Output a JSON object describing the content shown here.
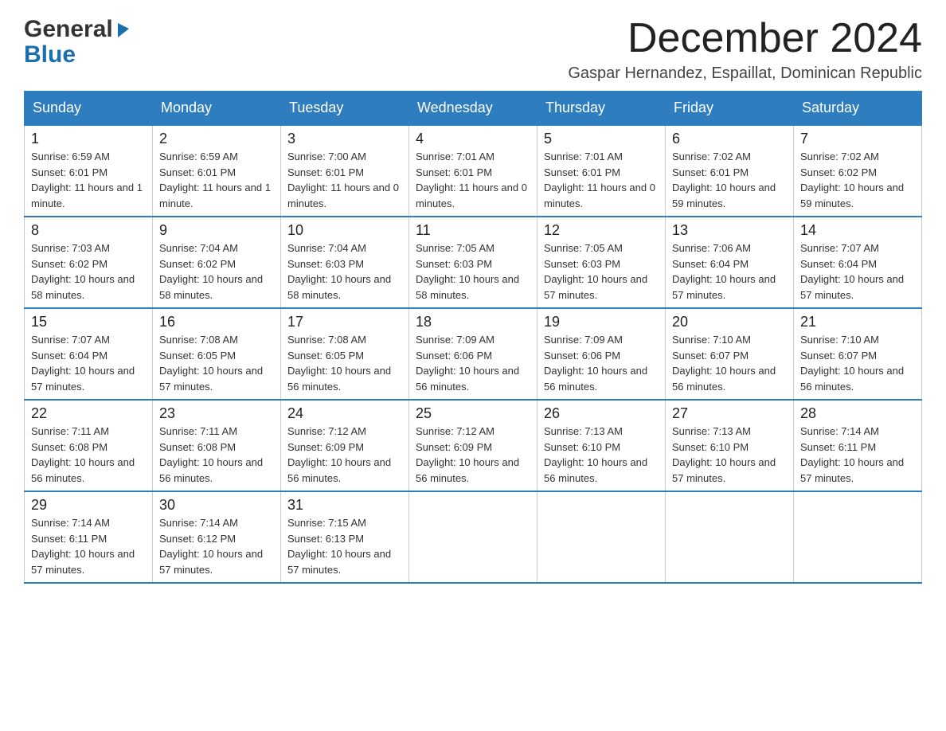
{
  "logo": {
    "general": "General",
    "blue": "Blue",
    "triangle": "▶"
  },
  "header": {
    "month_title": "December 2024",
    "subtitle": "Gaspar Hernandez, Espaillat, Dominican Republic"
  },
  "weekdays": [
    "Sunday",
    "Monday",
    "Tuesday",
    "Wednesday",
    "Thursday",
    "Friday",
    "Saturday"
  ],
  "weeks": [
    [
      {
        "day": "1",
        "sunrise": "6:59 AM",
        "sunset": "6:01 PM",
        "daylight": "11 hours and 1 minute."
      },
      {
        "day": "2",
        "sunrise": "6:59 AM",
        "sunset": "6:01 PM",
        "daylight": "11 hours and 1 minute."
      },
      {
        "day": "3",
        "sunrise": "7:00 AM",
        "sunset": "6:01 PM",
        "daylight": "11 hours and 0 minutes."
      },
      {
        "day": "4",
        "sunrise": "7:01 AM",
        "sunset": "6:01 PM",
        "daylight": "11 hours and 0 minutes."
      },
      {
        "day": "5",
        "sunrise": "7:01 AM",
        "sunset": "6:01 PM",
        "daylight": "11 hours and 0 minutes."
      },
      {
        "day": "6",
        "sunrise": "7:02 AM",
        "sunset": "6:01 PM",
        "daylight": "10 hours and 59 minutes."
      },
      {
        "day": "7",
        "sunrise": "7:02 AM",
        "sunset": "6:02 PM",
        "daylight": "10 hours and 59 minutes."
      }
    ],
    [
      {
        "day": "8",
        "sunrise": "7:03 AM",
        "sunset": "6:02 PM",
        "daylight": "10 hours and 58 minutes."
      },
      {
        "day": "9",
        "sunrise": "7:04 AM",
        "sunset": "6:02 PM",
        "daylight": "10 hours and 58 minutes."
      },
      {
        "day": "10",
        "sunrise": "7:04 AM",
        "sunset": "6:03 PM",
        "daylight": "10 hours and 58 minutes."
      },
      {
        "day": "11",
        "sunrise": "7:05 AM",
        "sunset": "6:03 PM",
        "daylight": "10 hours and 58 minutes."
      },
      {
        "day": "12",
        "sunrise": "7:05 AM",
        "sunset": "6:03 PM",
        "daylight": "10 hours and 57 minutes."
      },
      {
        "day": "13",
        "sunrise": "7:06 AM",
        "sunset": "6:04 PM",
        "daylight": "10 hours and 57 minutes."
      },
      {
        "day": "14",
        "sunrise": "7:07 AM",
        "sunset": "6:04 PM",
        "daylight": "10 hours and 57 minutes."
      }
    ],
    [
      {
        "day": "15",
        "sunrise": "7:07 AM",
        "sunset": "6:04 PM",
        "daylight": "10 hours and 57 minutes."
      },
      {
        "day": "16",
        "sunrise": "7:08 AM",
        "sunset": "6:05 PM",
        "daylight": "10 hours and 57 minutes."
      },
      {
        "day": "17",
        "sunrise": "7:08 AM",
        "sunset": "6:05 PM",
        "daylight": "10 hours and 56 minutes."
      },
      {
        "day": "18",
        "sunrise": "7:09 AM",
        "sunset": "6:06 PM",
        "daylight": "10 hours and 56 minutes."
      },
      {
        "day": "19",
        "sunrise": "7:09 AM",
        "sunset": "6:06 PM",
        "daylight": "10 hours and 56 minutes."
      },
      {
        "day": "20",
        "sunrise": "7:10 AM",
        "sunset": "6:07 PM",
        "daylight": "10 hours and 56 minutes."
      },
      {
        "day": "21",
        "sunrise": "7:10 AM",
        "sunset": "6:07 PM",
        "daylight": "10 hours and 56 minutes."
      }
    ],
    [
      {
        "day": "22",
        "sunrise": "7:11 AM",
        "sunset": "6:08 PM",
        "daylight": "10 hours and 56 minutes."
      },
      {
        "day": "23",
        "sunrise": "7:11 AM",
        "sunset": "6:08 PM",
        "daylight": "10 hours and 56 minutes."
      },
      {
        "day": "24",
        "sunrise": "7:12 AM",
        "sunset": "6:09 PM",
        "daylight": "10 hours and 56 minutes."
      },
      {
        "day": "25",
        "sunrise": "7:12 AM",
        "sunset": "6:09 PM",
        "daylight": "10 hours and 56 minutes."
      },
      {
        "day": "26",
        "sunrise": "7:13 AM",
        "sunset": "6:10 PM",
        "daylight": "10 hours and 56 minutes."
      },
      {
        "day": "27",
        "sunrise": "7:13 AM",
        "sunset": "6:10 PM",
        "daylight": "10 hours and 57 minutes."
      },
      {
        "day": "28",
        "sunrise": "7:14 AM",
        "sunset": "6:11 PM",
        "daylight": "10 hours and 57 minutes."
      }
    ],
    [
      {
        "day": "29",
        "sunrise": "7:14 AM",
        "sunset": "6:11 PM",
        "daylight": "10 hours and 57 minutes."
      },
      {
        "day": "30",
        "sunrise": "7:14 AM",
        "sunset": "6:12 PM",
        "daylight": "10 hours and 57 minutes."
      },
      {
        "day": "31",
        "sunrise": "7:15 AM",
        "sunset": "6:13 PM",
        "daylight": "10 hours and 57 minutes."
      },
      null,
      null,
      null,
      null
    ]
  ],
  "labels": {
    "sunrise": "Sunrise:",
    "sunset": "Sunset:",
    "daylight": "Daylight:"
  }
}
